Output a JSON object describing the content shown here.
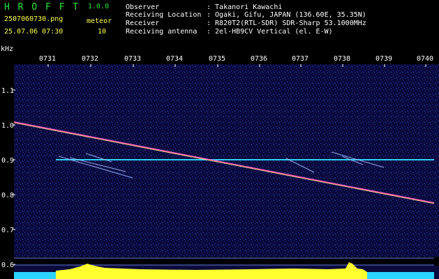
{
  "header": {
    "app_name": "H R O F F T",
    "version": "1.0.0",
    "filename": "2507060730.png",
    "timestamp": "25.07.06 07:30",
    "meteor_label": "meteor",
    "meteor_count": "10",
    "info_labels": [
      "Observer",
      "Receiving Location",
      "Receiver",
      "Receiving antenna"
    ],
    "info_values": [
      ": Takanori Kawachi",
      ": Ogaki, Gifu, JAPAN (136.60E, 35.35N)",
      ": R820T2(RTL-SDR) SDR-Sharp 53.1000MHz",
      ": 2el-HB9CV Vertical (el. E-W)"
    ]
  },
  "axis": {
    "y_unit": "kHz",
    "x_ticks": [
      "0731",
      "0732",
      "0733",
      "0734",
      "0735",
      "0736",
      "0737",
      "0738",
      "0739",
      "0740"
    ],
    "y_ticks": [
      "1.1",
      "1.0",
      "0.9",
      "0.8",
      "0.7",
      "0.6"
    ]
  },
  "colors": {
    "header_text": "#ffff4a",
    "app_name": "#29e63a",
    "background": "#0a0a3c",
    "carrier_line": "#2bd4ff",
    "histogram": "#ffff30"
  }
}
